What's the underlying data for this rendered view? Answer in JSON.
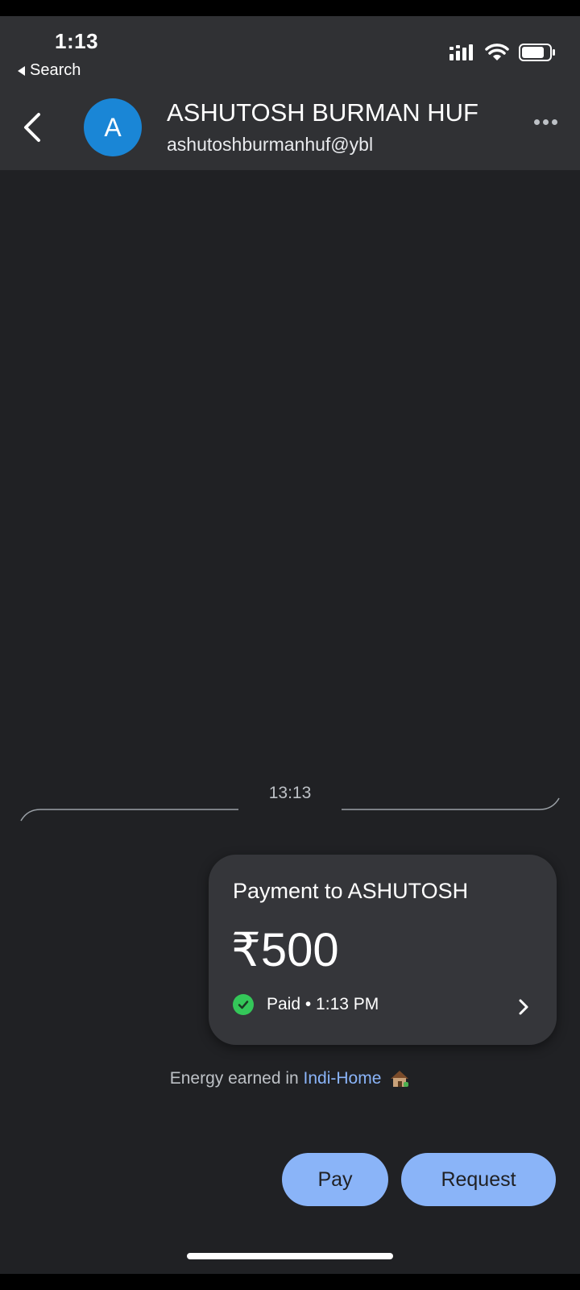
{
  "status_bar": {
    "time": "1:13",
    "back_label": "Search",
    "icons": [
      "signal-icon",
      "wifi-icon",
      "battery-icon"
    ]
  },
  "header": {
    "avatar_letter": "A",
    "name": "ASHUTOSH BURMAN HUF",
    "upi_id": "ashutoshburmanhuf@ybl",
    "icons": [
      "back-arrow-icon",
      "more-dots-icon"
    ]
  },
  "conversation": {
    "divider_time": "13:13",
    "payment_card": {
      "title": "Payment to ASHUTOSH",
      "amount": "₹500",
      "status": "Paid • 1:13 PM",
      "status_icon": "check-circle-icon"
    },
    "energy_note": {
      "prefix": "Energy earned in ",
      "link": "Indi-Home",
      "icon": "house-icon"
    }
  },
  "actions": {
    "pay_label": "Pay",
    "request_label": "Request"
  },
  "colors": {
    "background": "#202124",
    "header_background": "#303134",
    "card_background": "#35363a",
    "accent": "#8ab4f8",
    "avatar": "#1a86d6",
    "paid_green": "#34c759"
  }
}
